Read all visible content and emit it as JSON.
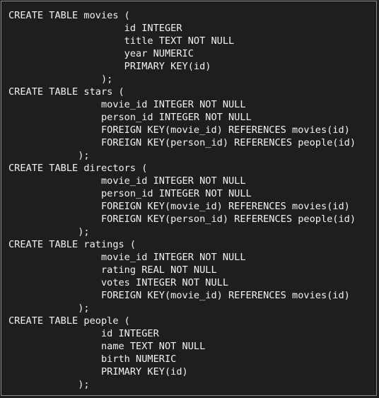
{
  "code": {
    "lines": [
      "CREATE TABLE movies (",
      "                    id INTEGER",
      "                    title TEXT NOT NULL",
      "                    year NUMERIC",
      "                    PRIMARY KEY(id)",
      "                );",
      "CREATE TABLE stars (",
      "                movie_id INTEGER NOT NULL",
      "                person_id INTEGER NOT NULL",
      "                FOREIGN KEY(movie_id) REFERENCES movies(id)",
      "                FOREIGN KEY(person_id) REFERENCES people(id)",
      "            );",
      "CREATE TABLE directors (",
      "                movie_id INTEGER NOT NULL",
      "                person_id INTEGER NOT NULL",
      "                FOREIGN KEY(movie_id) REFERENCES movies(id)",
      "                FOREIGN KEY(person_id) REFERENCES people(id)",
      "            );",
      "CREATE TABLE ratings (",
      "                movie_id INTEGER NOT NULL",
      "                rating REAL NOT NULL",
      "                votes INTEGER NOT NULL",
      "                FOREIGN KEY(movie_id) REFERENCES movies(id)",
      "            );",
      "CREATE TABLE people (",
      "                id INTEGER",
      "                name TEXT NOT NULL",
      "                birth NUMERIC",
      "                PRIMARY KEY(id)",
      "            );"
    ]
  }
}
